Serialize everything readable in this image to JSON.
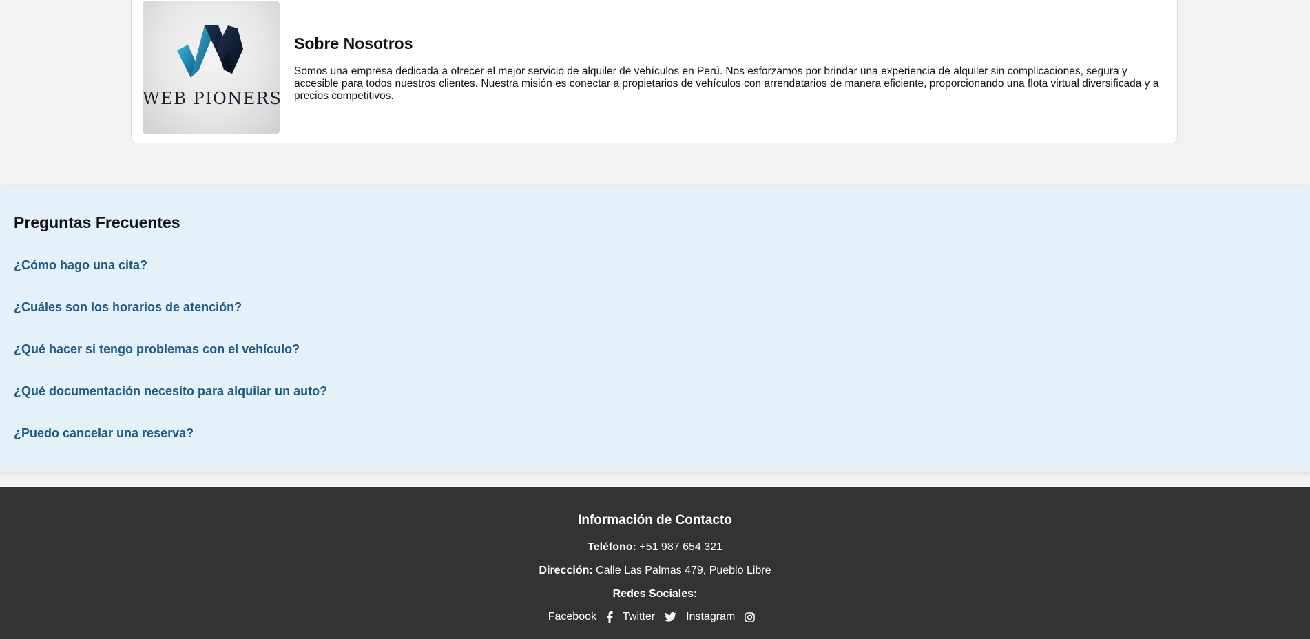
{
  "about": {
    "logo_text": "WEB PIONERS",
    "title": "Sobre Nosotros",
    "text": "Somos una empresa dedicada a ofrecer el mejor servicio de alquiler de vehículos en Perú. Nos esforzamos por brindar una experiencia de alquiler sin complicaciones, segura y accesible para todos nuestros clientes. Nuestra misión es conectar a propietarios de vehículos con arrendatarios de manera eficiente, proporcionando una flota virtual diversificada y a precios competitivos."
  },
  "faq": {
    "title": "Preguntas Frecuentes",
    "items": [
      "¿Cómo hago una cita?",
      "¿Cuáles son los horarios de atención?",
      "¿Qué hacer si tengo problemas con el vehículo?",
      "¿Qué documentación necesito para alquilar un auto?",
      "¿Puedo cancelar una reserva?"
    ]
  },
  "footer": {
    "title": "Información de Contacto",
    "phone_label": "Teléfono:",
    "phone_value": "+51 987 654 321",
    "address_label": "Dirección:",
    "address_value": "Calle Las Palmas 479, Pueblo Libre",
    "social_label": "Redes Sociales:",
    "social": [
      {
        "label": "Facebook",
        "icon": "facebook-icon"
      },
      {
        "label": "Twitter",
        "icon": "twitter-icon"
      },
      {
        "label": "Instagram",
        "icon": "instagram-icon"
      }
    ]
  },
  "colors": {
    "page_bg": "#f2f2f2",
    "faq_bg": "#e4f1f9",
    "faq_link": "#1a5a85",
    "footer_bg": "#333333",
    "logo_blue": "#1e8bb5",
    "logo_dark": "#0f1c33"
  }
}
